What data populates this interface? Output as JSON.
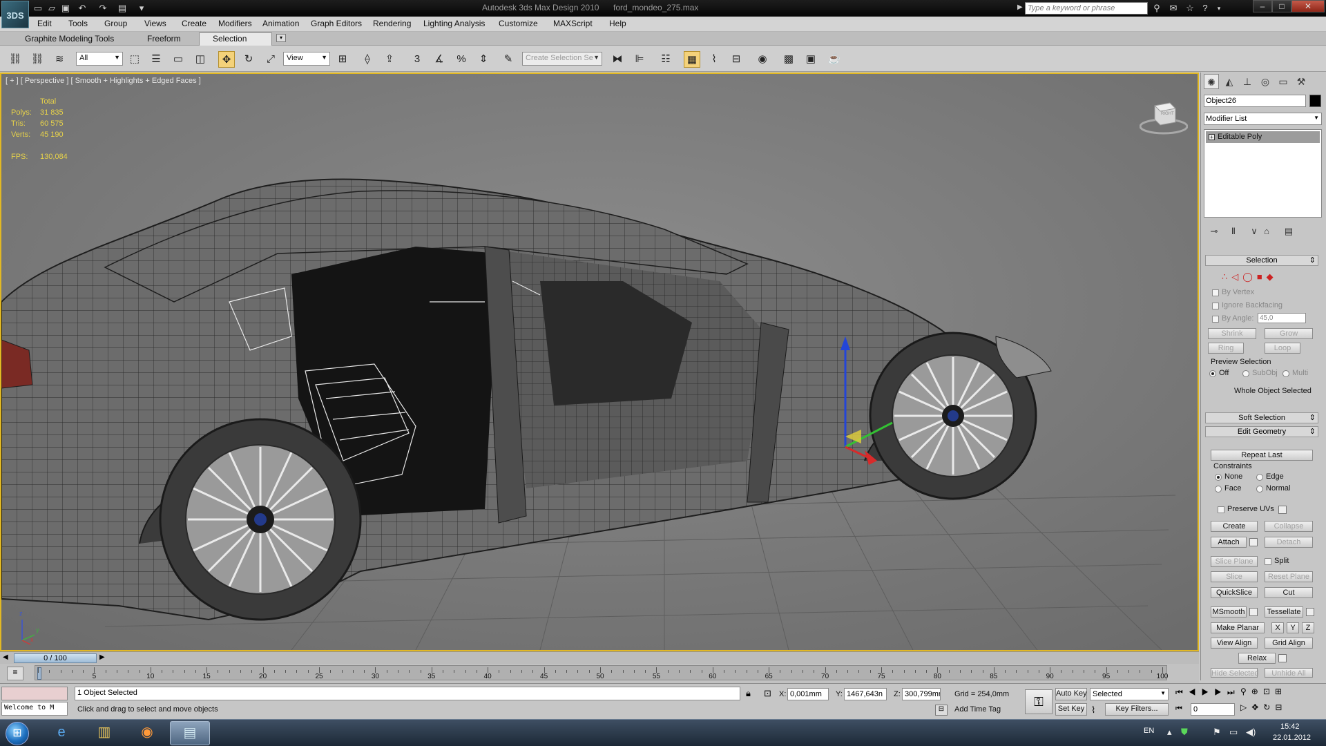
{
  "titlebar": {
    "app_title": "Autodesk 3ds Max Design 2010",
    "file_name": "ford_mondeo_275.max",
    "search_placeholder": "Type a keyword or phrase",
    "logo_text": "3DS"
  },
  "menubar": {
    "items": [
      "Edit",
      "Tools",
      "Group",
      "Views",
      "Create",
      "Modifiers",
      "Animation",
      "Graph Editors",
      "Rendering",
      "Lighting Analysis",
      "Customize",
      "MAXScript",
      "Help"
    ]
  },
  "ribbon": {
    "tabs": [
      "Graphite Modeling Tools",
      "Freeform",
      "Selection"
    ],
    "active_tab": "Selection"
  },
  "toolbar": {
    "filter_value": "All",
    "ref_coord_value": "View",
    "named_selection_placeholder": "Create Selection Se"
  },
  "viewport": {
    "label": "[ + ] [ Perspective ] [ Smooth + Highlights + Edged Faces ]",
    "stats": {
      "header": "Total",
      "polys_label": "Polys:",
      "polys_value": "31 835",
      "tris_label": "Tris:",
      "tris_value": "60 575",
      "verts_label": "Verts:",
      "verts_value": "45 190",
      "fps_label": "FPS:",
      "fps_value": "130,084"
    },
    "viewcube_face": "RIGHT",
    "axis_labels": {
      "x": "x",
      "y": "y",
      "z": "z"
    }
  },
  "command_panel": {
    "object_name": "Object26",
    "object_color": "#000000",
    "modifier_list": "Modifier List",
    "stack_item": "Editable Poly",
    "selection": {
      "title": "Selection",
      "by_vertex": "By Vertex",
      "ignore_backfacing": "Ignore Backfacing",
      "by_angle": "By Angle:",
      "angle_value": "45,0",
      "shrink": "Shrink",
      "grow": "Grow",
      "ring": "Ring",
      "loop": "Loop",
      "preview_selection": "Preview Selection",
      "preview_off": "Off",
      "preview_subobj": "SubObj",
      "preview_multi": "Multi",
      "whole_object": "Whole Object Selected"
    },
    "soft_selection": "Soft Selection",
    "edit_geometry": {
      "title": "Edit Geometry",
      "repeat_last": "Repeat Last",
      "constraints": "Constraints",
      "none": "None",
      "edge": "Edge",
      "face": "Face",
      "normal": "Normal",
      "preserve_uvs": "Preserve UVs",
      "create": "Create",
      "collapse": "Collapse",
      "attach": "Attach",
      "detach": "Detach",
      "slice_plane": "Slice Plane",
      "split": "Split",
      "slice": "Slice",
      "reset_plane": "Reset Plane",
      "quickslice": "QuickSlice",
      "cut": "Cut",
      "msmooth": "MSmooth",
      "tessellate": "Tessellate",
      "make_planar": "Make Planar",
      "x": "X",
      "y": "Y",
      "z": "Z",
      "view_align": "View Align",
      "grid_align": "Grid Align",
      "relax": "Relax",
      "hide_selected": "Hide Selected",
      "unhide_all": "Unhide All"
    }
  },
  "timeline": {
    "frame_display": "0 / 100",
    "ticks": [
      "5",
      "10",
      "15",
      "20",
      "25",
      "30",
      "35",
      "40",
      "45",
      "50",
      "55",
      "60",
      "65",
      "70",
      "75",
      "80",
      "85",
      "90",
      "95",
      "100"
    ]
  },
  "status": {
    "objects_selected": "1 Object Selected",
    "prompt": "Click and drag to select and move objects",
    "maxscript_listener": "Welcome to M",
    "x_label": "X:",
    "x_value": "0,001mm",
    "y_label": "Y:",
    "y_value": "1467,643n",
    "z_label": "Z:",
    "z_value": "300,799mr",
    "grid": "Grid = 254,0mm",
    "add_time_tag": "Add Time Tag",
    "auto_key": "Auto Key",
    "set_key": "Set Key",
    "selected_dropdown": "Selected",
    "key_filters": "Key Filters...",
    "current_frame": "0"
  },
  "taskbar": {
    "language": "EN",
    "time": "15:42",
    "date": "22.01.2012"
  }
}
